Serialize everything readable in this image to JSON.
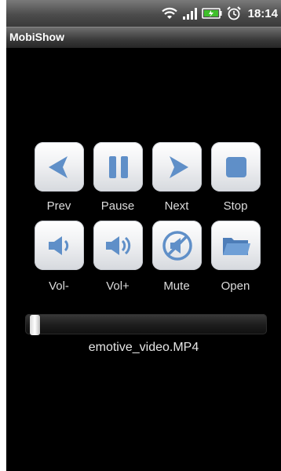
{
  "status_bar": {
    "time": "18:14",
    "icons": [
      "wifi-icon",
      "signal-icon",
      "battery-icon",
      "alarm-icon"
    ]
  },
  "app": {
    "title": "MobiShow"
  },
  "controls": {
    "row1": [
      {
        "label": "Prev",
        "icon": "prev-icon"
      },
      {
        "label": "Pause",
        "icon": "pause-icon"
      },
      {
        "label": "Next",
        "icon": "next-icon"
      },
      {
        "label": "Stop",
        "icon": "stop-icon"
      }
    ],
    "row2": [
      {
        "label": "Vol-",
        "icon": "volume-down-icon"
      },
      {
        "label": "Vol+",
        "icon": "volume-up-icon"
      },
      {
        "label": "Mute",
        "icon": "mute-icon"
      },
      {
        "label": "Open",
        "icon": "folder-icon"
      }
    ]
  },
  "player": {
    "filename": "emotive_video.MP4",
    "progress": 0.0
  },
  "colors": {
    "icon_blue": "#5f8fc8",
    "button_face": "#eef0f3",
    "background": "#000000"
  }
}
